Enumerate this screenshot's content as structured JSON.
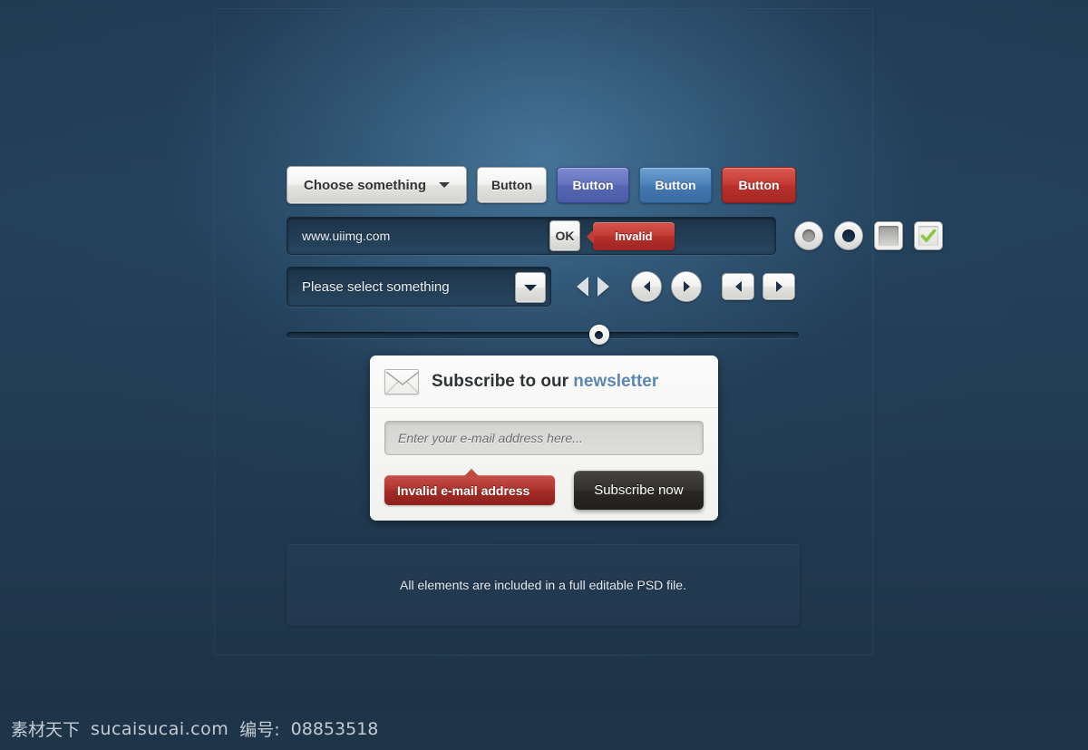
{
  "theme": {
    "page_bg": "#1e3449",
    "panel_bg": "#2a4a66",
    "accent_blue": "#5c86b3",
    "accent_red": "#c23b34",
    "accent_green": "#8dc63f",
    "dark_button": "#2b2927"
  },
  "row_buttons": {
    "select_label": "Choose something",
    "buttons": [
      {
        "label": "Button",
        "style": "plain"
      },
      {
        "label": "Button",
        "style": "purple"
      },
      {
        "label": "Button",
        "style": "blue"
      },
      {
        "label": "Button",
        "style": "red"
      }
    ]
  },
  "row_input": {
    "value": "www.uiimg.com",
    "ok_label": "OK",
    "invalid_label": "Invalid",
    "radio_off_name": "radio-unselected",
    "radio_on_name": "radio-selected",
    "checkbox_off_name": "checkbox-unchecked",
    "checkbox_on_name": "checkbox-checked"
  },
  "row_select": {
    "value": "Please select something",
    "caret_icon": "chevron-down-icon",
    "nav": {
      "flat_prev_icon": "triangle-left-icon",
      "flat_next_icon": "triangle-right-icon",
      "circle_prev_icon": "circle-arrow-left-icon",
      "circle_next_icon": "circle-arrow-right-icon",
      "rect_prev_icon": "rect-arrow-left-icon",
      "rect_next_icon": "rect-arrow-right-icon"
    }
  },
  "slider": {
    "value_percent": 61,
    "knob_name": "slider-knob"
  },
  "newsletter": {
    "icon": "envelope-icon",
    "title_prefix": "Subscribe to our ",
    "title_accent": "newsletter",
    "email_placeholder": "Enter your e-mail address here...",
    "error_label": "Invalid e-mail address",
    "submit_label": "Subscribe now"
  },
  "footer": {
    "note": "All elements are included in a full editable PSD file."
  },
  "watermark": {
    "brand": "素材天下",
    "site": "sucaisucai.com",
    "id_label": "编号:",
    "id_value": "08853518"
  }
}
